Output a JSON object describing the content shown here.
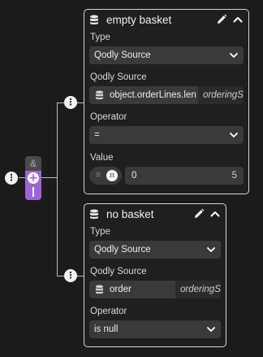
{
  "logic": {
    "and_label": "&",
    "or_label": "|"
  },
  "cards": [
    {
      "title": "empty basket",
      "type_label": "Type",
      "type_value": "Qodly Source",
      "source_label": "Qodly Source",
      "source_path": "object.orderLines.length",
      "source_datasource": "orderingSource",
      "operator_label": "Operator",
      "operator_value": "=",
      "value_label": "Value",
      "value_text": "0",
      "value_stepper": "5"
    },
    {
      "title": "no basket",
      "type_label": "Type",
      "type_value": "Qodly Source",
      "source_label": "Qodly Source",
      "source_path": "order",
      "source_datasource": "orderingSource",
      "operator_label": "Operator",
      "operator_value": "is null"
    }
  ],
  "icons": {
    "database": "database-icon",
    "edit": "pencil-icon",
    "collapse": "chevron-up-icon",
    "dropdown": "chevron-down-icon",
    "more": "vertical-dots-icon",
    "add": "plus-icon",
    "toggle_static": "equals-icon",
    "toggle_source": "pi-icon"
  },
  "colors": {
    "background": "#1b1b1b",
    "input_bg": "#3a3a3a",
    "accent_purple": "#9b65d6",
    "card_border": "#d6d6d6"
  }
}
